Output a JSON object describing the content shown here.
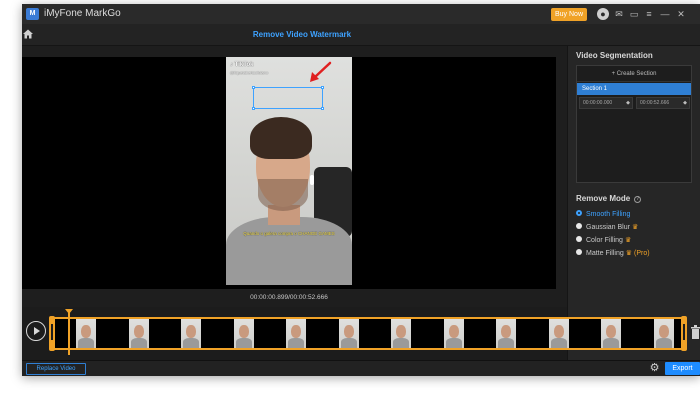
{
  "app": {
    "title": "iMyFone MarkGo",
    "logo_text": "M"
  },
  "titlebar": {
    "buy_label": "Buy Now",
    "icons": [
      "avatar-icon",
      "mail-icon",
      "chat-icon",
      "menu-icon",
      "minimize-icon",
      "close-icon"
    ],
    "icon_glyphs": {
      "avatar": "●",
      "mail": "✉",
      "chat": "▭",
      "menu": "≡",
      "minimize": "—",
      "close": "✕"
    }
  },
  "subheader": {
    "home_icon": "home-icon",
    "title": "Remove Video Watermark"
  },
  "video": {
    "tiktok_logo": "♪ TikTok",
    "tiktok_handle": "@fiqueiabertaofulano",
    "caption": "Quando o galera compra o CHANGE GAMES",
    "time_readout": "00:00:00.899/00:00:52.666"
  },
  "segmentation": {
    "title": "Video Segmentation",
    "create_label": "+ Create Section",
    "sections": [
      {
        "label": "Section 1",
        "start": "00:00:00.000",
        "end": "00:00:52.666"
      }
    ]
  },
  "remove_mode": {
    "title": "Remove Mode",
    "help_icon": "?",
    "options": [
      {
        "label": "Smooth Filling",
        "selected": true,
        "crown": false,
        "pro": ""
      },
      {
        "label": "Gaussian Blur",
        "selected": false,
        "crown": true,
        "pro": ""
      },
      {
        "label": "Color Filling",
        "selected": false,
        "crown": true,
        "pro": ""
      },
      {
        "label": "Matte Filling",
        "selected": false,
        "crown": true,
        "pro": "(Pro)"
      }
    ],
    "crown_glyph": "♛"
  },
  "timeline": {
    "thumbnail_count": 12,
    "playhead_time": "00:00:00.899"
  },
  "bottombar": {
    "replace_label": "Replace Video",
    "export_label": "Export",
    "gear_glyph": "⚙"
  },
  "colors": {
    "accent": "#3ea2ff",
    "brand_orange": "#f0a227",
    "export_blue": "#1e8cff",
    "background": "#1e1e1e"
  }
}
